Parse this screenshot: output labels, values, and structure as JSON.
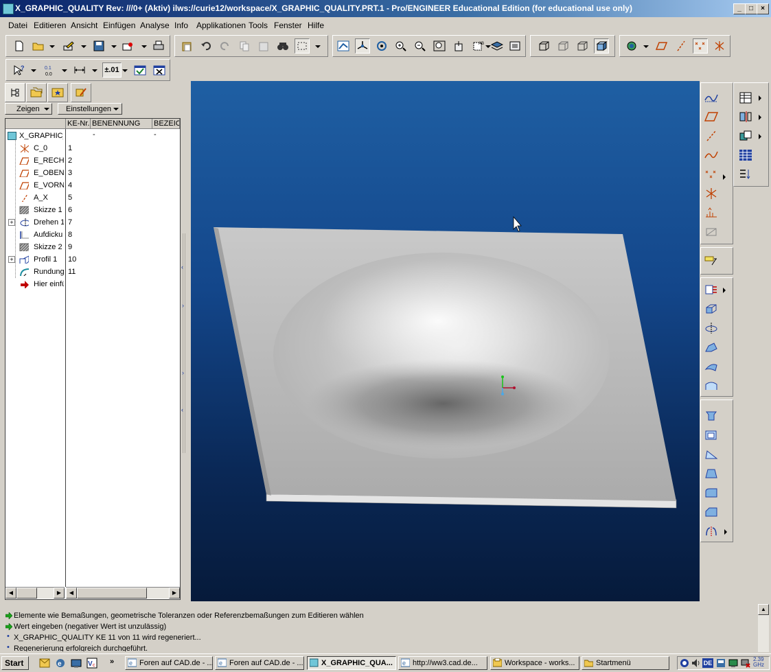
{
  "window": {
    "title": "X_GRAPHIC_QUALITY Rev: ///0+ (Aktiv) ilws://curie12/workspace/X_GRAPHIC_QUALITY.PRT.1 - Pro/ENGINEER Educational Edition (for educational use only)",
    "minimize": "_",
    "maximize": "□",
    "close": "×"
  },
  "menu": [
    "Datei",
    "Editieren",
    "Ansicht",
    "Einfügen",
    "Analyse",
    "Info",
    "Applikationen",
    "Tools",
    "Fenster",
    "Hilfe"
  ],
  "toolbar2": {
    "precision_label": "±.01"
  },
  "panel": {
    "show_button": "Zeigen",
    "settings_button": "Einstellungen",
    "columns": [
      "KE-Nr.",
      "BENENNUNG",
      "BEZEIC"
    ],
    "root": {
      "name": "X_GRAPHIC_",
      "c1": "-",
      "c2": "-"
    },
    "rows": [
      {
        "name": "C_0",
        "num": "1",
        "icon": "csys-icon"
      },
      {
        "name": "E_RECH",
        "num": "2",
        "icon": "datum-plane-icon"
      },
      {
        "name": "E_OBEN",
        "num": "3",
        "icon": "datum-plane-icon"
      },
      {
        "name": "E_VORN",
        "num": "4",
        "icon": "datum-plane-icon"
      },
      {
        "name": "A_X",
        "num": "5",
        "icon": "datum-axis-icon"
      },
      {
        "name": "Skizze 1",
        "num": "6",
        "icon": "sketch-icon"
      },
      {
        "name": "Drehen 1",
        "num": "7",
        "icon": "revolve-icon"
      },
      {
        "name": "Aufdicku",
        "num": "8",
        "icon": "thicken-icon"
      },
      {
        "name": "Skizze 2",
        "num": "9",
        "icon": "sketch-icon"
      },
      {
        "name": "Profil 1",
        "num": "10",
        "icon": "profile-icon"
      },
      {
        "name": "Rundung",
        "num": "11",
        "icon": "round-icon"
      },
      {
        "name": "Hier einfü",
        "num": "",
        "icon": "insert-here-icon"
      }
    ]
  },
  "messages": [
    "Elemente wie Bemaßungen, geometrische Toleranzen oder Referenzbemaßungen zum Editieren wählen",
    "Wert eingeben (negativer Wert ist unzulässig)",
    "X_GRAPHIC_QUALITY KE 11 von 11 wird regeneriert...",
    "Regenerierung erfolgreich durchgeführt."
  ],
  "taskbar": {
    "start": "Start",
    "quicklaunch_more": "»",
    "tasks": [
      "Foren auf CAD.de - ...",
      "Foren auf CAD.de - ...",
      "X_GRAPHIC_QUA...",
      "http://ww3.cad.de...",
      "Workspace - works...",
      "Startmenü"
    ],
    "language": "DE",
    "clock": "2.39 GHz"
  },
  "colors": {
    "title_gradient_start": "#0a246a",
    "viewport_top": "#1f5fa3",
    "viewport_bottom": "#061a3a",
    "message_arrow": "#1aa01a"
  }
}
